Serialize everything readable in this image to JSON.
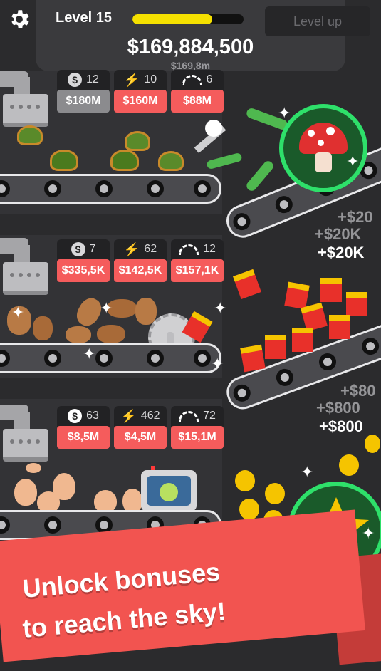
{
  "hud": {
    "level_label": "Level 15",
    "xp_progress": 0.72,
    "level_up_label": "Level up",
    "money": "$169,884,500",
    "money_sub": "$169,8m"
  },
  "rows": [
    {
      "product": "turtles-to-lizards",
      "stats": [
        {
          "icon": "coin-icon",
          "count": "12",
          "price": "$180M",
          "enabled": false
        },
        {
          "icon": "lightning-icon",
          "count": "10",
          "price": "$160M",
          "enabled": true
        },
        {
          "icon": "speedometer-icon",
          "count": "6",
          "price": "$88M",
          "enabled": true
        }
      ],
      "floats": [
        "+$20",
        "+$20K",
        "+$20K"
      ]
    },
    {
      "product": "potatoes-to-fries",
      "stats": [
        {
          "icon": "coin-icon",
          "count": "7",
          "price": "$335,5K",
          "enabled": true
        },
        {
          "icon": "lightning-icon",
          "count": "62",
          "price": "$142,5K",
          "enabled": true
        },
        {
          "icon": "speedometer-icon",
          "count": "12",
          "price": "$157,1K",
          "enabled": true
        }
      ]
    },
    {
      "product": "eggs-to-chicks",
      "stats": [
        {
          "icon": "coin-icon",
          "count": "63",
          "price": "$8,5M",
          "enabled": true
        },
        {
          "icon": "lightning-icon",
          "count": "462",
          "price": "$4,5M",
          "enabled": true
        },
        {
          "icon": "speedometer-icon",
          "count": "72",
          "price": "$15,1M",
          "enabled": true
        }
      ],
      "floats": [
        "+$80",
        "+$800",
        "+$800"
      ]
    }
  ],
  "bonuses": {
    "mushroom": "mushroom-icon",
    "star": "star-icon"
  },
  "banner": {
    "line1": "Unlock bonuses",
    "line2": "to reach the sky!"
  },
  "colors": {
    "background": "#2b2b2d",
    "accent_red": "#f55c5c",
    "xp_yellow": "#f5e000",
    "bonus_green": "#2ee06a"
  }
}
